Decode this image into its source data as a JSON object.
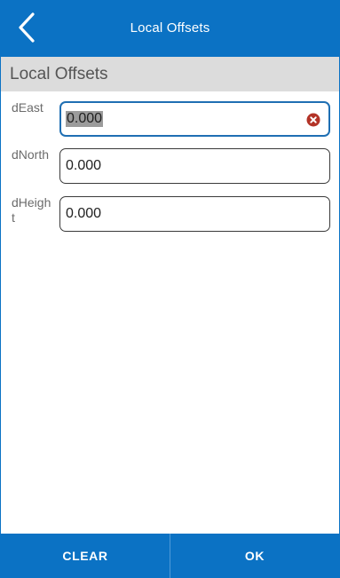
{
  "header": {
    "title": "Local Offsets",
    "back_icon": "chevron-left-icon"
  },
  "section": {
    "title": "Local Offsets"
  },
  "fields": [
    {
      "label": "dEast",
      "value": "0.000",
      "focused": true,
      "clear_icon": "clear-circle-icon"
    },
    {
      "label": "dNorth",
      "value": "0.000",
      "focused": false
    },
    {
      "label": "dHeight",
      "value": "0.000",
      "focused": false
    }
  ],
  "footer": {
    "clear_label": "CLEAR",
    "ok_label": "OK"
  },
  "colors": {
    "primary": "#0b72c4",
    "section_bg": "#dcdcdc",
    "focus_border": "#1f6fb3",
    "clear_icon": "#b33327"
  }
}
